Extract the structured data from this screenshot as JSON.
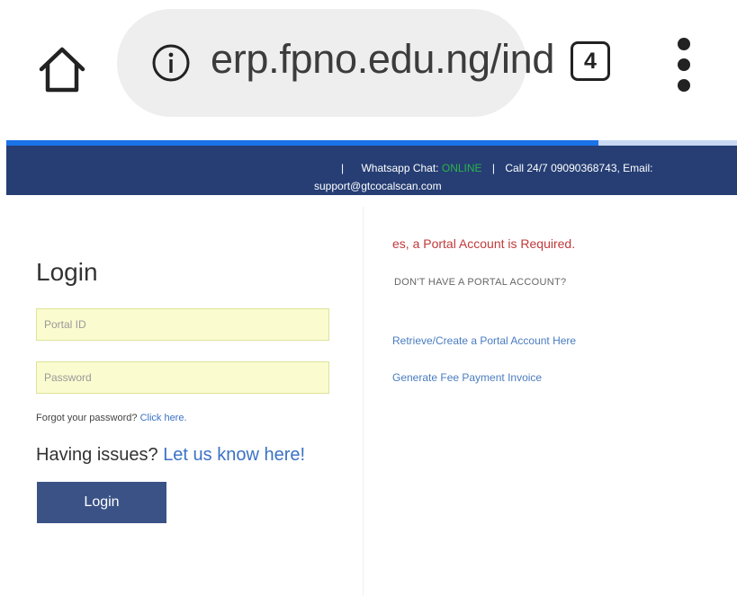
{
  "browser": {
    "url": "erp.fpno.edu.ng/ind",
    "tab_count": "4",
    "load_progress": 0.81
  },
  "topbar": {
    "separator": "|",
    "whatsapp_label": "Whatsapp Chat:",
    "whatsapp_status": "ONLINE",
    "call_label": "Call 24/7",
    "phone": "09090368743,",
    "email_label": "Email:",
    "email": "support@gtcocalscan.com"
  },
  "login": {
    "title": "Login",
    "portal_id_placeholder": "Portal ID",
    "password_placeholder": "Password",
    "forgot_text": "Forgot your password?",
    "forgot_link": "Click here.",
    "issues_text": "Having issues?",
    "issues_link": "Let us know here!",
    "button_label": "Login"
  },
  "info": {
    "notice": "es, a Portal Account is Required.",
    "no_account": "DON'T HAVE A PORTAL ACCOUNT?",
    "retrieve_link": "Retrieve/Create a Portal Account Here",
    "invoice_link": "Generate Fee Payment Invoice"
  },
  "colors": {
    "topbar_bg": "#263e74",
    "online": "#2bb24c",
    "link": "#3a72c4",
    "notice": "#c0393b",
    "field_bg": "#fafbcf",
    "button_bg": "#3a5286",
    "progress": "#1a73e8"
  },
  "icons": [
    "home-icon",
    "info-icon",
    "more-vert-icon"
  ]
}
